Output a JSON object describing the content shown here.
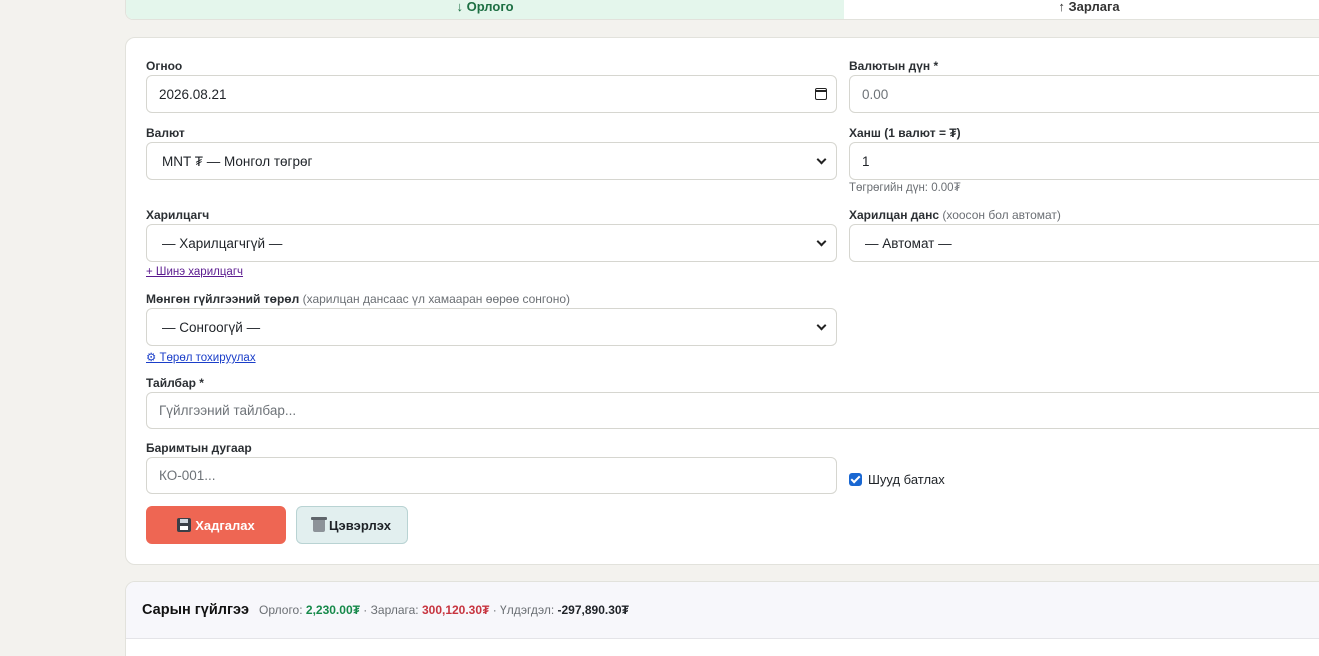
{
  "tabs": {
    "income_label": "↓ Орлого",
    "expense_label": "↑ Зарлага"
  },
  "form": {
    "date_label": "Огноо",
    "date_value": "2026.08.21",
    "amount_label": "Валютын дүн *",
    "amount_placeholder": "0.00",
    "currency_label": "Валют",
    "currency_value": "MNT ₮ — Монгол төгрөг",
    "rate_label": "Ханш (1 валют = ₮)",
    "rate_value": "1",
    "mnt_amount_text": "Төгрөгийн дүн: 0.00₮",
    "partner_label": "Харилцагч",
    "partner_value": "— Харилцагчгүй —",
    "new_partner_link": "+ Шинэ харилцагч",
    "account_label": "Харилцан данс",
    "account_hint": "(хоосон бол автомат)",
    "account_value": "— Автомат —",
    "type_label": "Мөнгөн гүйлгээний төрөл",
    "type_hint": "(харилцан дансаас үл хамааран өөрөө сонгоно)",
    "type_value": "— Сонгоогүй —",
    "type_settings_link": "⚙ Төрөл тохируулах",
    "description_label": "Тайлбар *",
    "description_placeholder": "Гүйлгээний тайлбар...",
    "doc_number_label": "Баримтын дугаар",
    "doc_number_placeholder": "КО-001...",
    "auto_confirm_label": "Шууд батлах",
    "auto_confirm_checked": true,
    "save_label": "Хадгалах",
    "clear_label": "Цэвэрлэх"
  },
  "summary": {
    "title": "Сарын гүйлгээ",
    "income_label": "Орлого:",
    "income_value": "2,230.00₮",
    "sep1": "·",
    "expense_label": "Зарлага:",
    "expense_value": "300,120.30₮",
    "sep2": "·",
    "balance_label": "Үлдэгдэл:",
    "balance_value": "-297,890.30₮"
  },
  "colors": {
    "income_tab_bg": "#e4f6ec",
    "save_button": "#ee6653",
    "income_value": "#16894a",
    "expense_value": "#c7343f"
  }
}
